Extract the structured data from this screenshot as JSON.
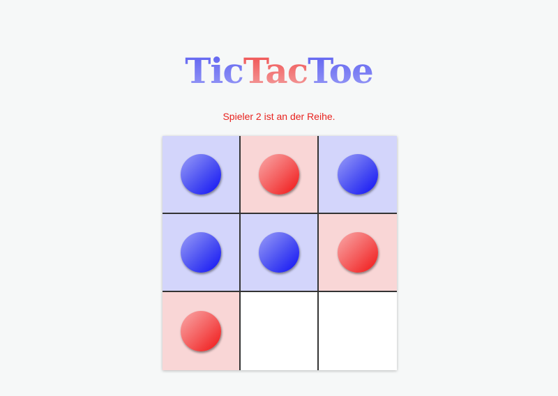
{
  "title": {
    "parts": [
      "Tic",
      "Tac",
      "Toe"
    ]
  },
  "status": "Spieler 2 ist an der Reihe.",
  "colors": {
    "player1": "#3b3ff2",
    "player2": "#f02828",
    "status": "#e8221e"
  },
  "board": {
    "cells": [
      "blue",
      "red",
      "blue",
      "blue",
      "blue",
      "red",
      "red",
      "empty",
      "empty"
    ]
  }
}
